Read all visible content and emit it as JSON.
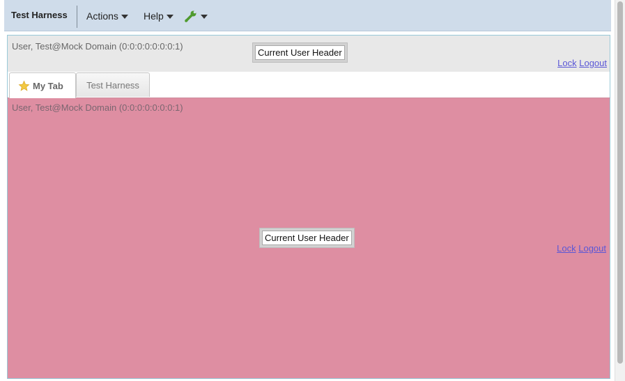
{
  "navbar": {
    "brand": "Test Harness",
    "menus": {
      "actions": "Actions",
      "help": "Help"
    },
    "tools_icon": "wrench-icon"
  },
  "header": {
    "user_info": "User, Test@Mock Domain (0:0:0:0:0:0:0:1)",
    "button_label": "Current User Header",
    "lock_link": "Lock",
    "logout_link": "Logout"
  },
  "tabs": [
    {
      "label": "My Tab",
      "icon": "star-icon",
      "active": true
    },
    {
      "label": "Test Harness",
      "active": false
    }
  ],
  "content": {
    "user_info": "User, Test@Mock Domain (0:0:0:0:0:0:0:1)",
    "button_label": "Current User Header",
    "lock_link": "Lock",
    "logout_link": "Logout"
  },
  "colors": {
    "navbar_bg": "#cfdcea",
    "header_bg": "#e8e8e8",
    "content_bg": "#de8ea2",
    "link": "#5a57d6",
    "wrench": "#4f9a2e",
    "star": "#f2c842"
  }
}
